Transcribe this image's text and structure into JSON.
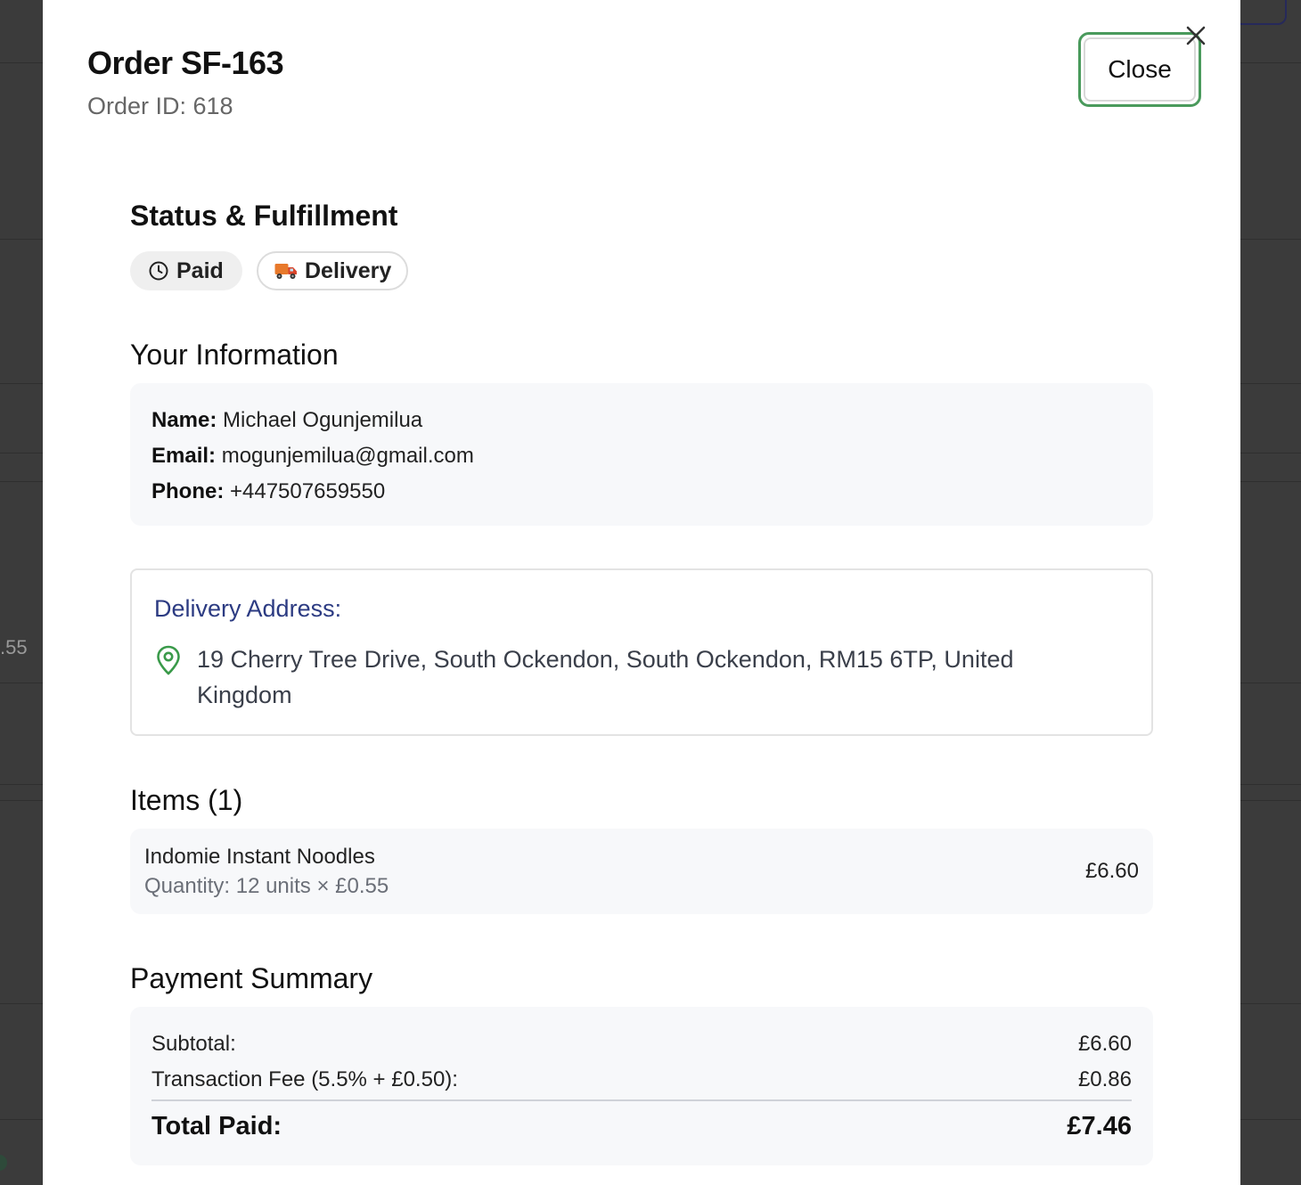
{
  "background": {
    "partial_text": ".55"
  },
  "modal": {
    "title": "Order SF-163",
    "subtitle": "Order ID: 618",
    "close_label": "Close"
  },
  "status": {
    "heading": "Status & Fulfillment",
    "payment_badge": "Paid",
    "fulfillment_badge": "Delivery"
  },
  "customer": {
    "heading": "Your Information",
    "name_label": "Name:",
    "name_value": "Michael Ogunjemilua",
    "email_label": "Email:",
    "email_value": "mogunjemilua@gmail.com",
    "phone_label": "Phone:",
    "phone_value": "+447507659550"
  },
  "address": {
    "heading": "Delivery Address:",
    "text": "19 Cherry Tree Drive, South Ockendon, South Ockendon, RM15 6TP, United Kingdom"
  },
  "items": {
    "heading": "Items (1)",
    "list": [
      {
        "name": "Indomie Instant Noodles",
        "quantity_text": "Quantity: 12 units × £0.55",
        "price": "£6.60"
      }
    ]
  },
  "payment": {
    "heading": "Payment Summary",
    "subtotal_label": "Subtotal:",
    "subtotal_value": "£6.60",
    "fee_label": "Transaction Fee (5.5% + £0.50):",
    "fee_value": "£0.86",
    "total_label": "Total Paid:",
    "total_value": "£7.46"
  },
  "colors": {
    "focus_ring": "#4a9a5c",
    "address_heading": "#2c3b82",
    "pin_icon": "#3a9a4a"
  }
}
